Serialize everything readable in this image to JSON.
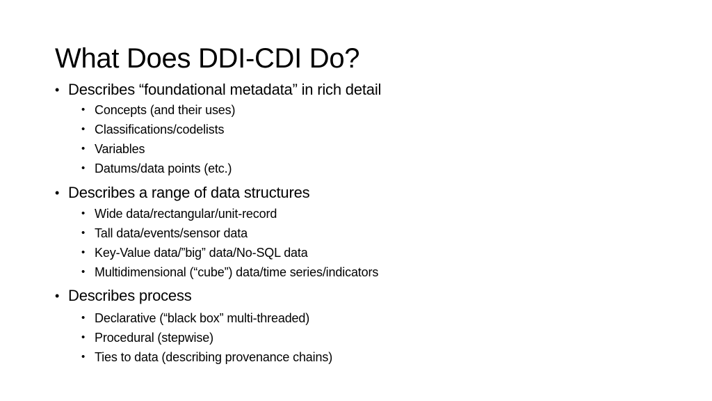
{
  "slide": {
    "title": "What Does DDI-CDI Do?",
    "bullet_glyph": "•",
    "sections": [
      {
        "label": "Describes “foundational metadata” in rich detail",
        "items": [
          "Concepts (and their uses)",
          "Classifications/codelists",
          "Variables",
          "Datums/data points (etc.)"
        ]
      },
      {
        "label": "Describes a range of data structures",
        "items": [
          "Wide data/rectangular/unit-record",
          "Tall data/events/sensor data",
          "Key-Value data/”big” data/No-SQL data",
          "Multidimensional (“cube”) data/time series/indicators"
        ]
      },
      {
        "label": "Describes process",
        "items": [
          "Declarative (“black box” multi-threaded)",
          "Procedural (stepwise)",
          "Ties to data (describing provenance chains)"
        ]
      }
    ]
  }
}
